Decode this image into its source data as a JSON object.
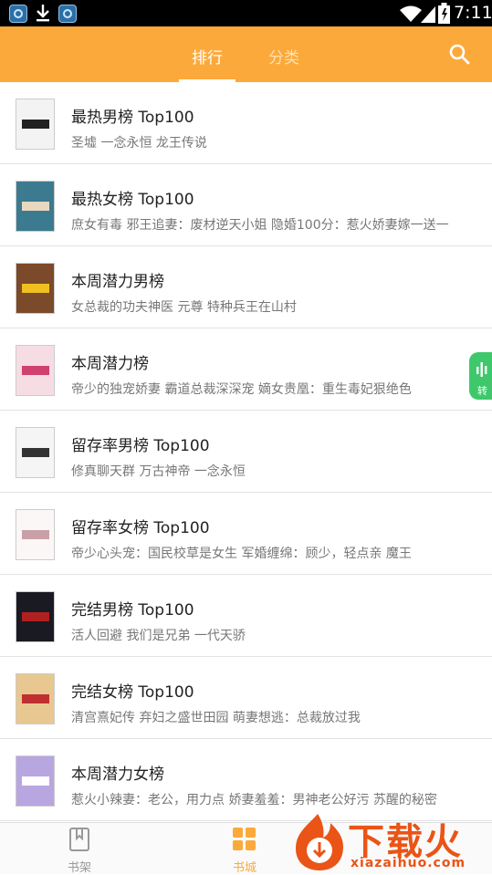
{
  "status_bar": {
    "time": "7:11"
  },
  "header": {
    "tabs": [
      {
        "label": "排行",
        "active": true
      },
      {
        "label": "分类",
        "active": false
      }
    ],
    "accent_color": "#fca93b"
  },
  "rankings": [
    {
      "title": "最热男榜 Top100",
      "books": "圣墟 一念永恒 龙王传说",
      "cover_colors": [
        "#f3f3f3",
        "#222222"
      ]
    },
    {
      "title": "最热女榜 Top100",
      "books": "庶女有毒 邪王追妻：废材逆天小姐 隐婚100分：惹火娇妻嫁一送一",
      "cover_colors": [
        "#3c7a90",
        "#e8d8c0"
      ]
    },
    {
      "title": "本周潜力男榜",
      "books": "女总裁的功夫神医 元尊 特种兵王在山村",
      "cover_colors": [
        "#7a4a2a",
        "#f0c020"
      ]
    },
    {
      "title": "本周潜力榜",
      "books": "帝少的独宠娇妻 霸道总裁深深宠 嫡女贵凰：重生毒妃狠绝色",
      "cover_colors": [
        "#f6dde4",
        "#d04070"
      ]
    },
    {
      "title": "留存率男榜 Top100",
      "books": "修真聊天群 万古神帝 一念永恒",
      "cover_colors": [
        "#f5f5f5",
        "#333333"
      ]
    },
    {
      "title": "留存率女榜 Top100",
      "books": "帝少心头宠：国民校草是女生 军婚缠绵：顾少，轻点亲 魔王",
      "cover_colors": [
        "#fbf7f7",
        "#c9a0a8"
      ]
    },
    {
      "title": "完结男榜 Top100",
      "books": "活人回避 我们是兄弟 一代天骄",
      "cover_colors": [
        "#1a1a22",
        "#b02020"
      ]
    },
    {
      "title": "完结女榜 Top100",
      "books": "清宫熹妃传 弃妇之盛世田园 萌妻想逃：总裁放过我",
      "cover_colors": [
        "#e8c890",
        "#c03030"
      ]
    },
    {
      "title": "本周潜力女榜",
      "books": "惹火小辣妻：老公，用力点 娇妻羞羞：男神老公好污 苏醒的秘密",
      "cover_colors": [
        "#b8a6e0",
        "#ffffff"
      ]
    }
  ],
  "floating_button": {
    "label": "转",
    "color": "#3fc86b"
  },
  "bottom_nav": [
    {
      "label": "书架",
      "active": false
    },
    {
      "label": "书城",
      "active": true
    }
  ],
  "watermark": {
    "brand": "下载火",
    "domain": "xiazaihuo.com"
  }
}
